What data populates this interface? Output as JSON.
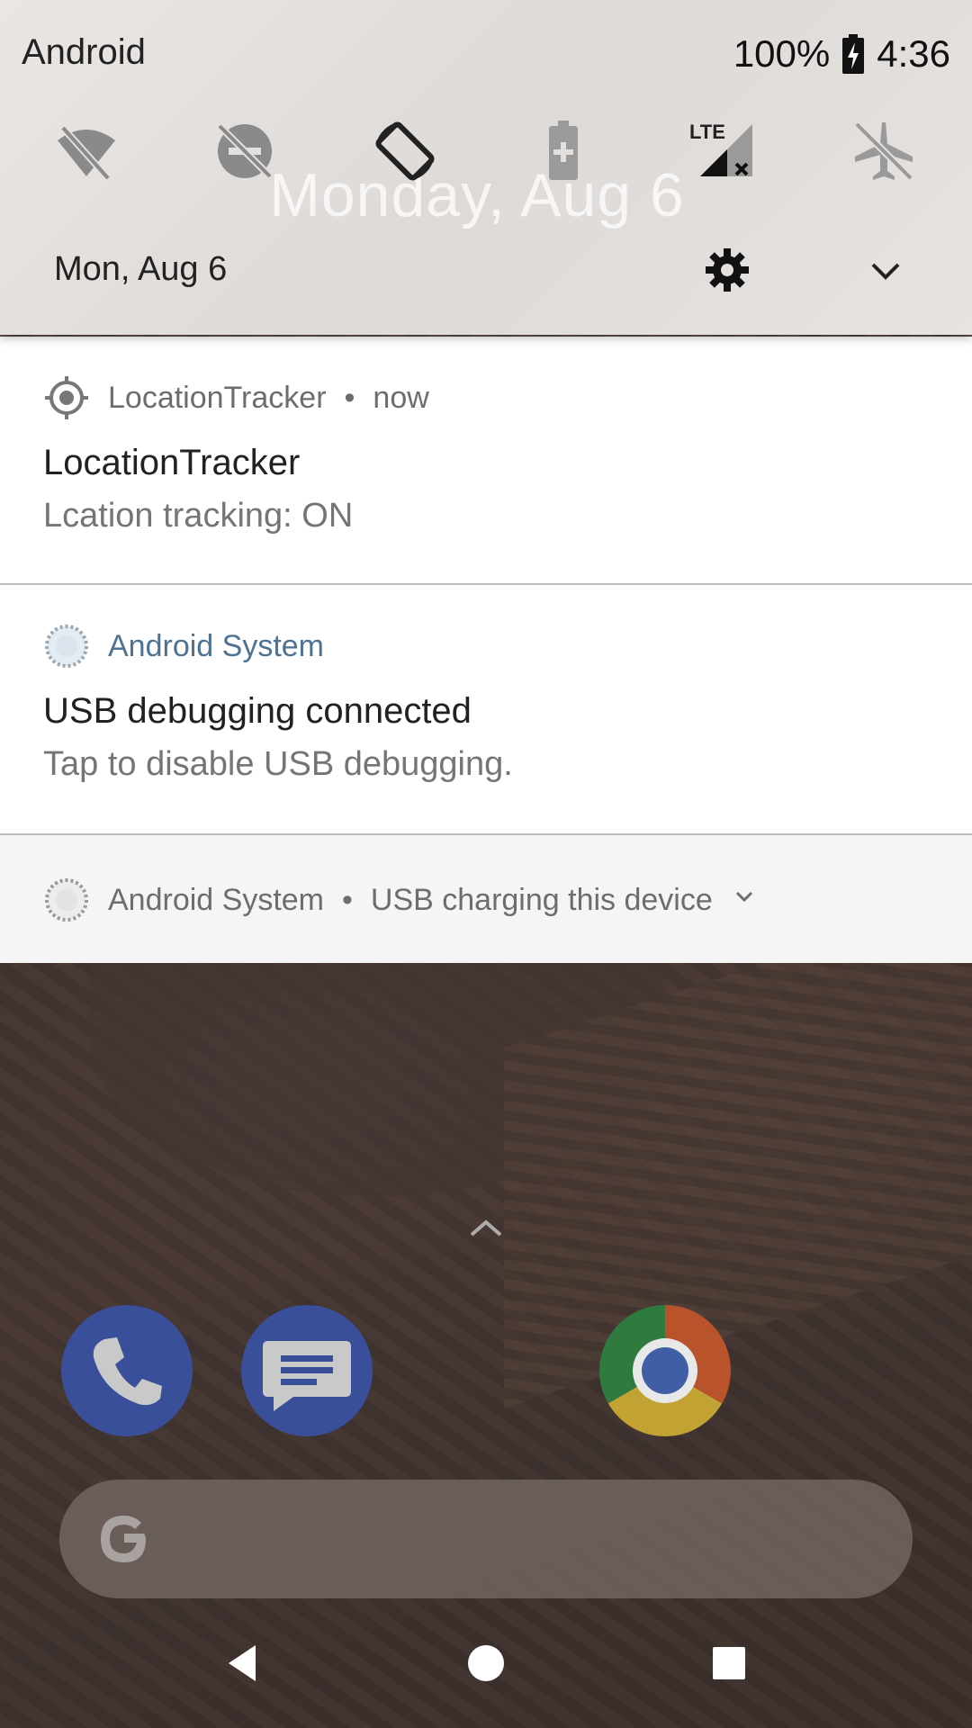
{
  "status_bar": {
    "carrier": "Android",
    "battery_percent": "100%",
    "time": "4:36"
  },
  "quick_settings": {
    "big_date": "Monday, Aug 6",
    "date": "Mon, Aug 6",
    "tiles": [
      {
        "name": "wifi-off-icon"
      },
      {
        "name": "dnd-off-icon"
      },
      {
        "name": "auto-rotate-icon"
      },
      {
        "name": "battery-saver-icon"
      },
      {
        "name": "mobile-data-lte-icon",
        "label": "LTE"
      },
      {
        "name": "airplane-mode-icon"
      }
    ]
  },
  "notifications": [
    {
      "app": "LocationTracker",
      "time": "now",
      "title": "LocationTracker",
      "text": "Lcation tracking: ON"
    },
    {
      "app": "Android System",
      "title": "USB debugging connected",
      "text": "Tap to disable USB debugging."
    },
    {
      "app": "Android System",
      "summary": "USB charging this device"
    }
  ],
  "colors": {
    "accent_app_name": "#4e7392",
    "notification_bg": "#ffffff",
    "qs_bg": "#e6e3e0"
  }
}
